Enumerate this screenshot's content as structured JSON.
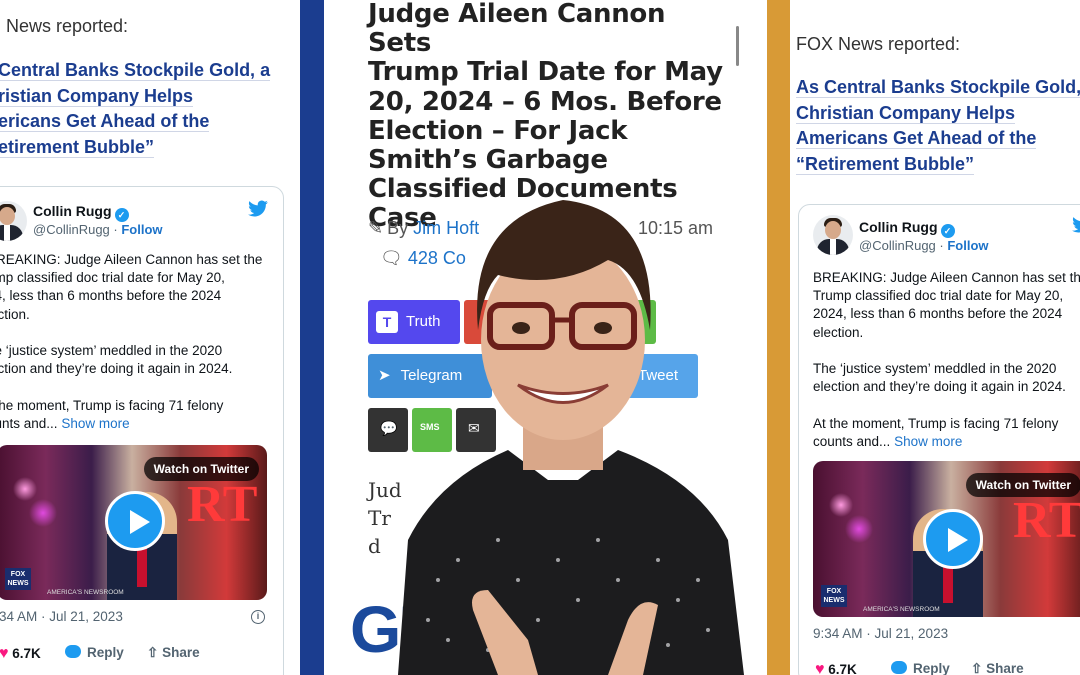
{
  "left": {
    "reported": "News reported:",
    "headline_lines": [
      "Central Banks Stockpile Gold, a",
      "ristian Company Helps",
      "ericans Get Ahead of the",
      "etirement Bubble”"
    ],
    "tweet": {
      "name": "Collin Rugg",
      "handle": "@CollinRugg",
      "follow": "Follow",
      "text": "BREAKING: Judge Aileen Cannon has set the\nump classified doc trial date for May 20,\n24, less than 6 months before the 2024\nlection.\n\nhe ‘justice system’ meddled in the 2020\nlection and they’re doing it again in 2024.\n\nt the moment, Trump is facing 71 felony\nounts and...",
      "show_more": "Show more",
      "watch": "Watch on Twitter",
      "fox": "FOX NEWS",
      "newsroom": "AMERICA'S NEWSROOM",
      "time": "34 AM · Jul 21, 2023",
      "likes": "6.7K",
      "reply": "Reply",
      "share": "Share"
    }
  },
  "middle": {
    "headline_lines": [
      "Judge Aileen Cannon Sets",
      "Trump Trial Date for May",
      "20, 2024 – 6 Mos. Before",
      "Election – For Jack",
      "Smith’s Garbage",
      "Classified Documents",
      "Case"
    ],
    "by": "By",
    "author": "Jim Hoft",
    "time": "10:15 am",
    "comments": "428 Co",
    "buttons": {
      "truth": "Truth",
      "telegram": "Telegram",
      "tweet": "Tweet",
      "sms": "SMS"
    },
    "article_fragments": [
      "Jud",
      "Tr",
      "d"
    ],
    "logo": "GP"
  },
  "right": {
    "reported": "FOX News reported:",
    "headline_lines": [
      "As Central Banks Stockpile Gold,",
      "Christian Company Helps",
      "Americans Get Ahead of the",
      "“Retirement Bubble”"
    ],
    "tweet": {
      "name": "Collin Rugg",
      "handle": "@CollinRugg",
      "follow": "Follow",
      "text": "BREAKING: Judge Aileen Cannon has set th\nTrump classified doc trial date for May 20,\n2024, less than 6 months before the 2024\nelection.\n\nThe ‘justice system’ meddled in the 2020\nelection and they’re doing it again in 2024.\n\nAt the moment, Trump is facing 71 felony\ncounts and...",
      "show_more": "Show more",
      "watch": "Watch on Twitter",
      "fox": "FOX NEWS",
      "newsroom": "AMERICA'S NEWSROOM",
      "time": "9:34 AM · Jul 21, 2023",
      "likes": "6.7K",
      "reply": "Reply",
      "share": "Share"
    }
  },
  "colors": {
    "gp_blue": "#1b3d8f",
    "accent_orange": "#d89a36",
    "link_blue": "#1d73c9",
    "twitter_blue": "#1d9bf0",
    "truth_purple": "#5448ee",
    "telegram_blue": "#3f8fd8",
    "sms_green": "#5dbb46"
  }
}
